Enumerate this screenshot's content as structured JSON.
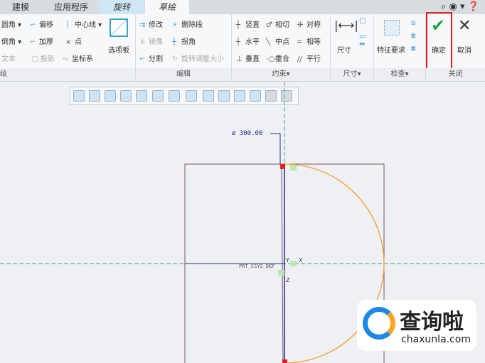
{
  "tabs": [
    "建模",
    "应用程序",
    "旋转",
    "草绘"
  ],
  "ribbon": {
    "sketch": {
      "items": [
        "圆角",
        "偏移",
        "中心线",
        "倒角",
        "加厚",
        "点",
        "文本",
        "投影",
        "坐标系"
      ],
      "palette": "选项板",
      "label": "绘"
    },
    "edit": {
      "items": [
        "修改",
        "删除段",
        "镜像",
        "拐角",
        "分割",
        "旋转调整大小"
      ],
      "label": "编辑"
    },
    "constrain": {
      "items": [
        "竖直",
        "相切",
        "对称",
        "水平",
        "中点",
        "相等",
        "垂直",
        "重合",
        "平行"
      ],
      "label": "约束▾"
    },
    "dimension": {
      "button": "尺寸",
      "label": "尺寸▾"
    },
    "inspect": {
      "button": "特征要求",
      "label": "检查▾"
    },
    "close": {
      "ok": "确定",
      "cancel": "取消",
      "label": "关闭"
    }
  },
  "canvas": {
    "dimension": "ø 300.00",
    "csys": "PRT_CSYS_DEF",
    "axes": [
      "X",
      "Y",
      "Z"
    ]
  },
  "watermark": {
    "name": "查询啦",
    "url": "chaxunla.com"
  },
  "colors": {
    "accent": "#2aa14a",
    "highlight": "#e02020",
    "arc": "#f0a030"
  }
}
